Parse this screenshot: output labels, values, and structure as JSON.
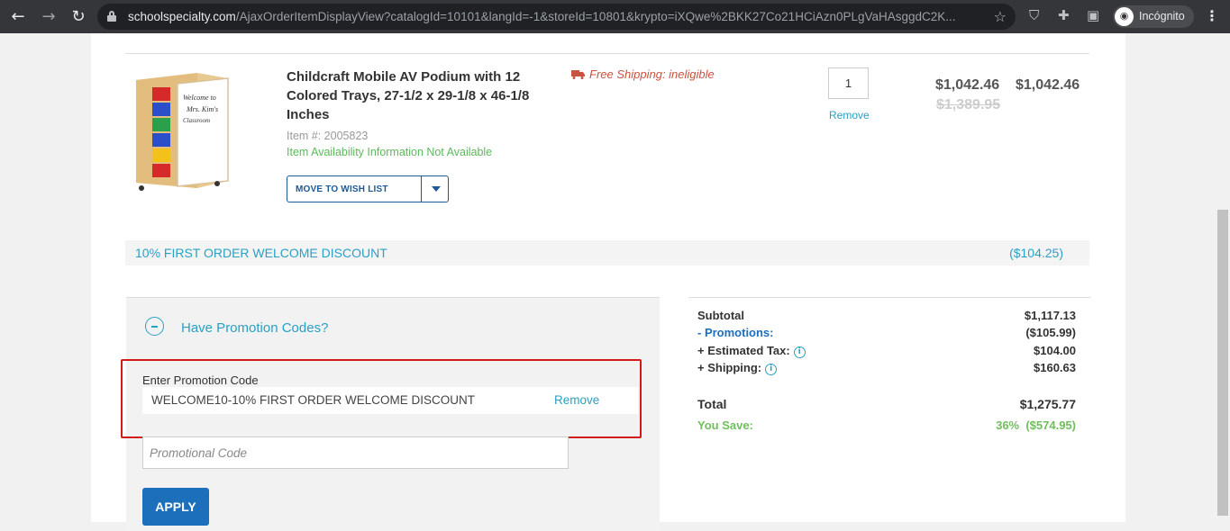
{
  "browser": {
    "url_host": "schoolspecialty.com",
    "url_path": "/AjaxOrderItemDisplayView?catalogId=10101&langId=-1&storeId=10801&krypto=iXQwe%2BKK27Co21HCiAzn0PLgVaHAsggdC2K...",
    "profile_label": "Incógnito",
    "icons": [
      "back-arrow-icon",
      "forward-arrow-icon",
      "reload-icon",
      "lock-icon",
      "star-icon",
      "shield-icon",
      "puzzle-icon",
      "sidebar-icon",
      "incognito-icon",
      "more-icon"
    ]
  },
  "item": {
    "title": "Childcraft Mobile AV Podium with 12 Colored Trays, 27-1/2 x 29-1/8 x 46-1/8 Inches",
    "item_number": "Item #: 2005823",
    "availability": "Item Availability Information Not Available",
    "wish_list_label": "MOVE TO WISH LIST",
    "shipping": "Free Shipping: ineligible",
    "quantity": "1",
    "remove_label": "Remove",
    "unit_price": "$1,042.46",
    "original_price": "$1,389.95",
    "line_total": "$1,042.46",
    "image_whiteboard_text": "Welcome to Mrs. Kim's Classroom"
  },
  "discount": {
    "name": "10% FIRST ORDER WELCOME DISCOUNT",
    "amount": "($104.25)"
  },
  "promo": {
    "toggle_label": "Have Promotion Codes?",
    "enter_label": "Enter Promotion Code",
    "applied_code": "WELCOME10-10% FIRST ORDER WELCOME DISCOUNT",
    "applied_remove": "Remove",
    "input_placeholder": "Promotional Code",
    "apply_label": "APPLY"
  },
  "summary": {
    "subtotal_label": "Subtotal",
    "subtotal": "$1,117.13",
    "promotions_label": "- Promotions:",
    "promotions": "($105.99)",
    "tax_label": "+ Estimated Tax:",
    "tax": "$104.00",
    "shipping_label": "+ Shipping:",
    "shipping": "$160.63",
    "total_label": "Total",
    "total": "$1,275.77",
    "save_label": "You Save:",
    "save": "36%  ($574.95)"
  },
  "colors": {
    "accent": "#2aa0c4",
    "brand_blue": "#1c6fba",
    "highlight": "#d21a1a",
    "savings_green": "#6fbf5c",
    "shipping_red": "#c8533f"
  }
}
